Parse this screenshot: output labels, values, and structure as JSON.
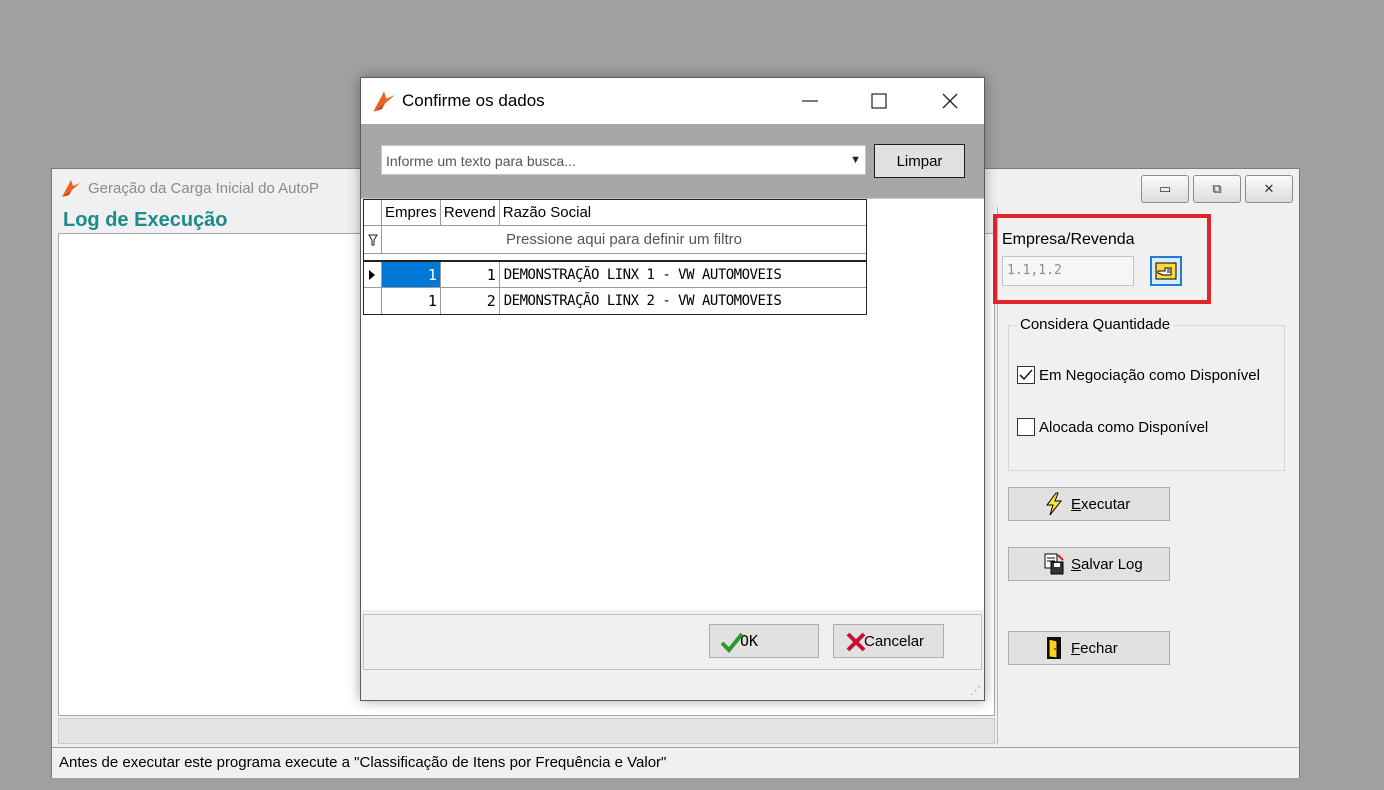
{
  "main_window": {
    "title": "Geração da Carga Inicial do AutoP",
    "log_title": "Log de Execução",
    "status_text": "Antes de executar este programa execute a \"Classificação de Itens por Frequência e Valor\""
  },
  "right_panel": {
    "empresa_label": "Empresa/Revenda",
    "empresa_value": "1.1,1.2",
    "qty_group_label": "Considera Quantidade",
    "checkboxes": [
      {
        "label": "Em Negociação como Disponível",
        "checked": true
      },
      {
        "label": "Alocada como Disponível",
        "checked": false
      }
    ],
    "buttons": {
      "executar": "Executar",
      "salvar_log": "Salvar Log",
      "fechar": "Fechar"
    }
  },
  "dialog": {
    "title": "Confirme os dados",
    "search_placeholder": "Informe um texto para busca...",
    "limpar_label": "Limpar",
    "grid": {
      "headers": [
        "Empres",
        "Revend",
        "Razão Social"
      ],
      "filter_hint": "Pressione aqui para definir um filtro",
      "rows": [
        {
          "empresa": "1",
          "revenda": "1",
          "razao": "DEMONSTRAÇÃO LINX 1 - VW AUTOMOVEIS",
          "selected": true
        },
        {
          "empresa": "1",
          "revenda": "2",
          "razao": "DEMONSTRAÇÃO LINX 2 - VW AUTOMOVEIS",
          "selected": false
        }
      ]
    },
    "ok_label": "OK",
    "cancel_label": "Cancelar"
  },
  "colors": {
    "desktop": "#a0a0a0",
    "log_title": "#1a8c8c",
    "highlight_box": "#e0242d",
    "selection": "#0078d7"
  },
  "icons": [
    "app-logo-icon",
    "minimize-icon",
    "maximize-icon",
    "close-icon",
    "lookup-hand-icon",
    "lightning-icon",
    "save-log-icon",
    "door-exit-icon",
    "checkmark-icon",
    "cancel-x-icon",
    "filter-icon",
    "row-pointer-icon",
    "dropdown-arrow-icon"
  ]
}
